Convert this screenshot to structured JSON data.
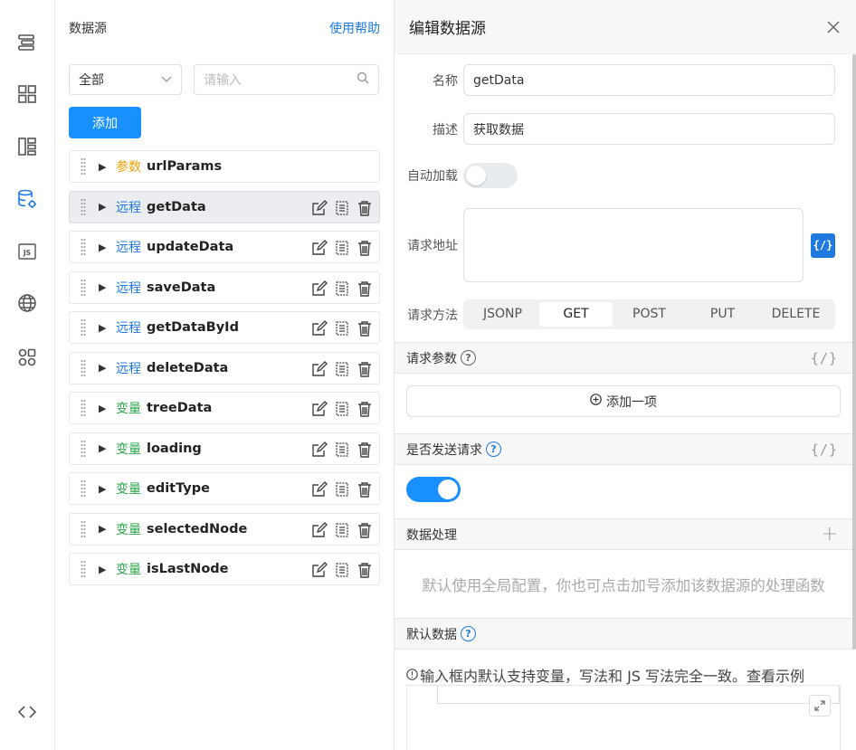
{
  "rail": {
    "icons": [
      "outline-icon",
      "components-icon",
      "layout-icon",
      "datasource-icon",
      "js-icon",
      "globe-icon",
      "apps-icon",
      "code-icon"
    ]
  },
  "datasource": {
    "title": "数据源",
    "help": "使用帮助",
    "filter_value": "全部",
    "search_placeholder": "请输入",
    "add_label": "添加",
    "items": [
      {
        "tag": "参数",
        "kind": "param",
        "name": "urlParams"
      },
      {
        "tag": "远程",
        "kind": "remote",
        "name": "getData"
      },
      {
        "tag": "远程",
        "kind": "remote",
        "name": "updateData"
      },
      {
        "tag": "远程",
        "kind": "remote",
        "name": "saveData"
      },
      {
        "tag": "远程",
        "kind": "remote",
        "name": "getDataById"
      },
      {
        "tag": "远程",
        "kind": "remote",
        "name": "deleteData"
      },
      {
        "tag": "变量",
        "kind": "var",
        "name": "treeData"
      },
      {
        "tag": "变量",
        "kind": "var",
        "name": "loading"
      },
      {
        "tag": "变量",
        "kind": "var",
        "name": "editType"
      },
      {
        "tag": "变量",
        "kind": "var",
        "name": "selectedNode"
      },
      {
        "tag": "变量",
        "kind": "var",
        "name": "isLastNode"
      }
    ]
  },
  "editor": {
    "title": "编辑数据源",
    "name_label": "名称",
    "name_value": "getData",
    "desc_label": "描述",
    "desc_value": "获取数据",
    "autoload_label": "自动加载",
    "url_label": "请求地址",
    "fx_label": "{/}",
    "method_label": "请求方法",
    "methods": [
      "JSONP",
      "GET",
      "POST",
      "PUT",
      "DELETE"
    ],
    "method_selected": "GET",
    "params_title": "请求参数",
    "add_item_label": "添加一项",
    "send_title": "是否发送请求",
    "process_title": "数据处理",
    "process_hint": "默认使用全局配置，你也可点击加号添加该数据源的处理函数",
    "default_title": "默认数据",
    "default_note": "输入框内默认支持变量，写法和 JS 写法完全一致。查看示例"
  }
}
